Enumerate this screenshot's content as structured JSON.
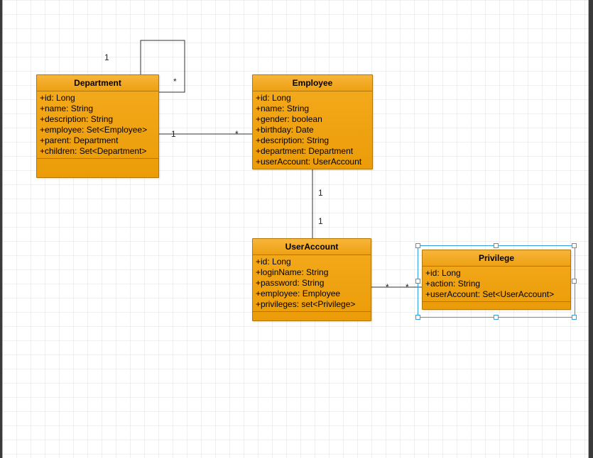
{
  "classes": {
    "department": {
      "title": "Department",
      "attrs": [
        "+id: Long",
        "+name: String",
        "+description: String",
        "+employee: Set<Employee>",
        "+parent: Department",
        "+children: Set<Department>"
      ]
    },
    "employee": {
      "title": "Employee",
      "attrs": [
        "+id: Long",
        "+name: String",
        "+gender: boolean",
        "+birthday: Date",
        "+description: String",
        "+department: Department",
        "+userAccount: UserAccount"
      ]
    },
    "userAccount": {
      "title": "UserAccount",
      "attrs": [
        "+id: Long",
        "+loginName: String",
        "+password: String",
        "+employee: Employee",
        "+privileges: set<Privilege>"
      ]
    },
    "privilege": {
      "title": "Privilege",
      "attrs": [
        "+id: Long",
        "+action: String",
        "+userAccount: Set<UserAccount>"
      ]
    }
  },
  "multiplicities": {
    "dept_self_top": "1",
    "dept_self_right": "*",
    "dept_emp_left": "1",
    "dept_emp_right": "*",
    "emp_ua_top": "1",
    "emp_ua_bottom": "1",
    "ua_priv_left": "*",
    "ua_priv_right": "*"
  }
}
